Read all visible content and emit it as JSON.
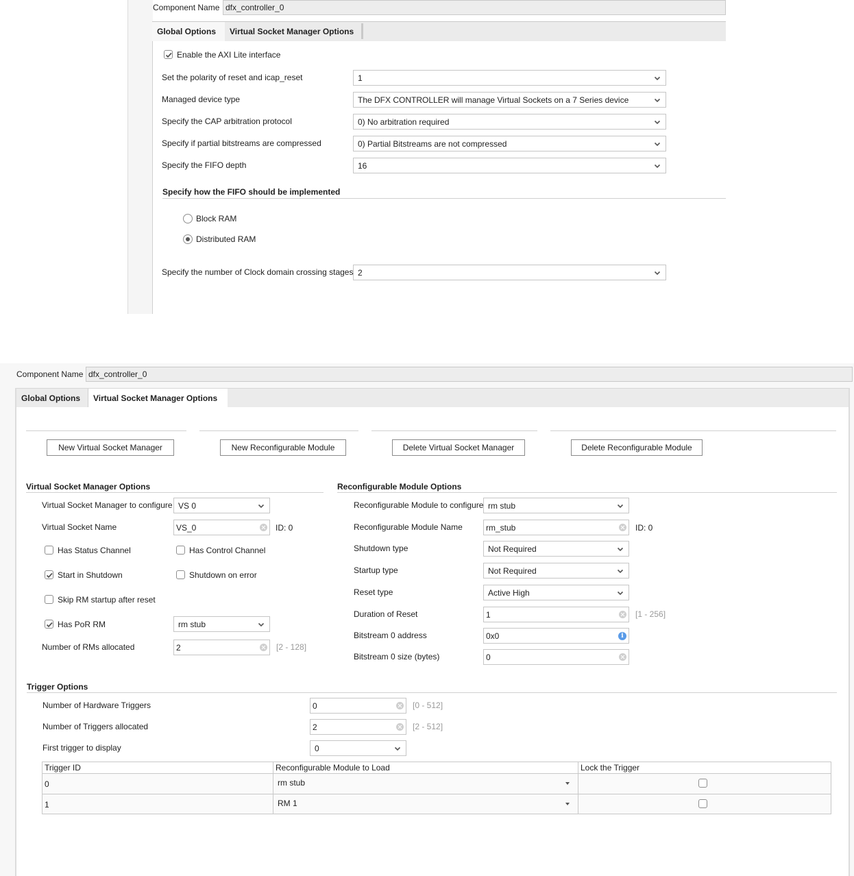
{
  "panel1": {
    "component_name_label": "Component Name",
    "component_name_value": "dfx_controller_0",
    "tabs": [
      {
        "label": "Global Options",
        "active": true
      },
      {
        "label": "Virtual Socket Manager Options",
        "active": false
      }
    ],
    "enable_axi_lite": {
      "label": "Enable the AXI Lite interface",
      "checked": true
    },
    "fields": [
      {
        "label": "Set the polarity of reset and icap_reset",
        "value": "1"
      },
      {
        "label": "Managed device type",
        "value": "The DFX CONTROLLER will manage Virtual Sockets on a 7 Series device"
      },
      {
        "label": "Specify the CAP arbitration protocol",
        "value": "0) No arbitration required"
      },
      {
        "label": "Specify if partial bitstreams are compressed",
        "value": "0) Partial Bitstreams are not compressed"
      },
      {
        "label": "Specify the FIFO depth",
        "value": "16"
      }
    ],
    "fifo_section_title": "Specify how the FIFO should be implemented",
    "fifo_options": [
      {
        "label": "Block RAM",
        "selected": false
      },
      {
        "label": "Distributed RAM",
        "selected": true
      }
    ],
    "cdc_field": {
      "label": "Specify the number of Clock domain crossing stages",
      "value": "2"
    }
  },
  "panel2": {
    "component_name_label": "Component Name",
    "component_name_value": "dfx_controller_0",
    "tabs": [
      {
        "label": "Global Options",
        "active": false
      },
      {
        "label": "Virtual Socket Manager Options",
        "active": true
      }
    ],
    "buttons": {
      "new_vsm": "New Virtual Socket Manager",
      "new_rm": "New Reconfigurable Module",
      "delete_vsm": "Delete Virtual Socket Manager",
      "delete_rm": "Delete Reconfigurable Module"
    },
    "vsm": {
      "title": "Virtual Socket Manager Options",
      "to_configure": {
        "label": "Virtual Socket Manager to configure",
        "value": "VS 0"
      },
      "name": {
        "label": "Virtual Socket Name",
        "value": "VS_0",
        "id_text": "ID: 0"
      },
      "has_status_channel": {
        "label": "Has Status Channel",
        "checked": false
      },
      "has_control_channel": {
        "label": "Has Control Channel",
        "checked": false
      },
      "start_in_shutdown": {
        "label": "Start in Shutdown",
        "checked": true
      },
      "shutdown_on_error": {
        "label": "Shutdown on error",
        "checked": false
      },
      "skip_rm_startup": {
        "label": "Skip RM startup after reset",
        "checked": false
      },
      "has_por_rm": {
        "label": "Has PoR RM",
        "checked": true,
        "value": "rm stub"
      },
      "num_rms": {
        "label": "Number of RMs allocated",
        "value": "2",
        "range": "[2 - 128]"
      }
    },
    "rm": {
      "title": "Reconfigurable Module Options",
      "to_configure": {
        "label": "Reconfigurable Module to configure",
        "value": "rm stub"
      },
      "name": {
        "label": "Reconfigurable Module Name",
        "value": "rm_stub",
        "id_text": "ID: 0"
      },
      "shutdown_type": {
        "label": "Shutdown type",
        "value": "Not Required"
      },
      "startup_type": {
        "label": "Startup type",
        "value": "Not Required"
      },
      "reset_type": {
        "label": "Reset type",
        "value": "Active High"
      },
      "reset_duration": {
        "label": "Duration of Reset",
        "value": "1",
        "range": "[1 - 256]"
      },
      "bs0_address": {
        "label": "Bitstream 0 address",
        "value": "0x0"
      },
      "bs0_size": {
        "label": "Bitstream 0 size (bytes)",
        "value": "0"
      }
    },
    "trigger": {
      "title": "Trigger Options",
      "hw_triggers": {
        "label": "Number of Hardware Triggers",
        "value": "0",
        "range": "[0 - 512]"
      },
      "triggers_allocated": {
        "label": "Number of Triggers allocated",
        "value": "2",
        "range": "[2 - 512]"
      },
      "first_trigger": {
        "label": "First trigger to display",
        "value": "0"
      },
      "table": {
        "columns": [
          "Trigger ID",
          "Reconfigurable Module to Load",
          "Lock the Trigger"
        ],
        "rows": [
          {
            "id": "0",
            "module": "rm stub",
            "locked": false
          },
          {
            "id": "1",
            "module": "RM 1",
            "locked": false
          }
        ]
      }
    }
  }
}
